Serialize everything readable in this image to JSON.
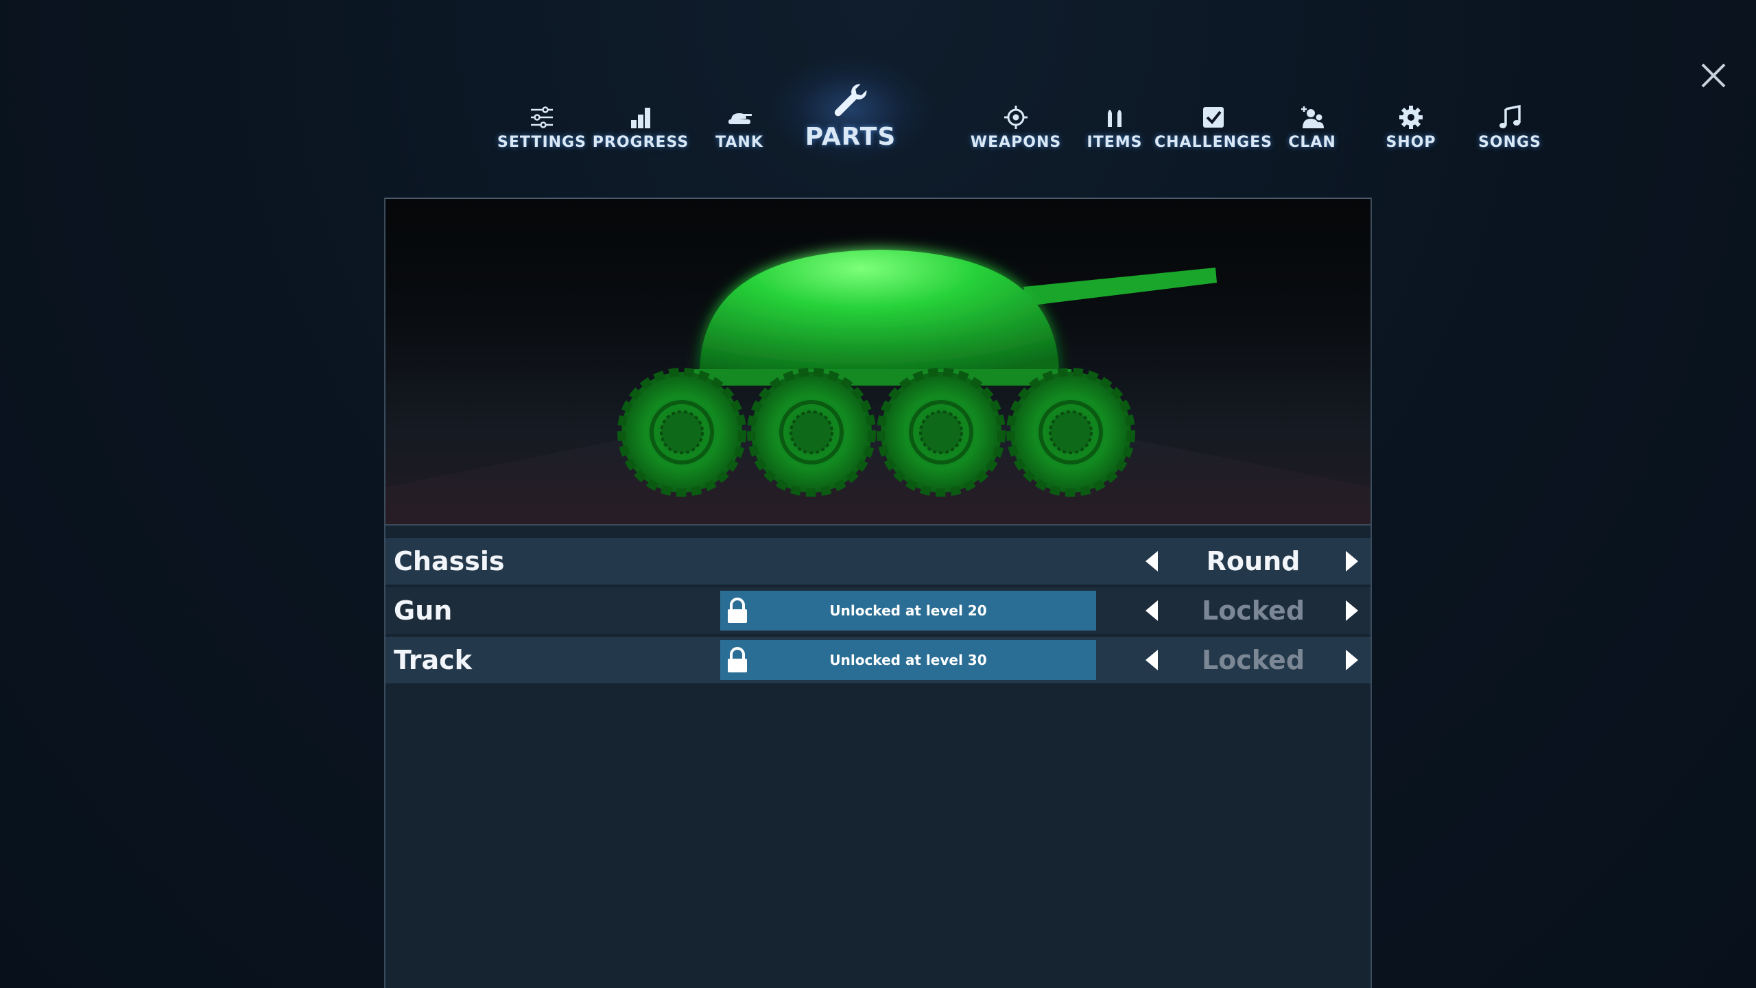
{
  "nav": {
    "items": [
      {
        "label": "SETTINGS",
        "icon": "sliders-icon"
      },
      {
        "label": "PROGRESS",
        "icon": "bar-chart-icon"
      },
      {
        "label": "TANK",
        "icon": "tank-icon"
      },
      {
        "label": "PARTS",
        "icon": "wrench-icon",
        "active": true
      },
      {
        "label": "WEAPONS",
        "icon": "crosshair-icon"
      },
      {
        "label": "ITEMS",
        "icon": "shells-icon"
      },
      {
        "label": "CHALLENGES",
        "icon": "checkbox-icon"
      },
      {
        "label": "CLAN",
        "icon": "group-add-icon"
      },
      {
        "label": "SHOP",
        "icon": "gear-badge-icon"
      },
      {
        "label": "SONGS",
        "icon": "music-note-icon"
      }
    ]
  },
  "close": {
    "icon": "close-icon"
  },
  "preview": {
    "tank_color": "#1fb52e"
  },
  "parts": {
    "rows": [
      {
        "label": "Chassis",
        "value": "Round",
        "locked": false
      },
      {
        "label": "Gun",
        "value": "Locked",
        "locked": true,
        "lock_text": "Unlocked at level 20"
      },
      {
        "label": "Track",
        "value": "Locked",
        "locked": true,
        "lock_text": "Unlocked at level 30"
      }
    ]
  },
  "colors": {
    "background": "#0b1420",
    "panel": "#162432",
    "lock_banner": "#2b6e95",
    "locked_text": "#7b8794"
  }
}
